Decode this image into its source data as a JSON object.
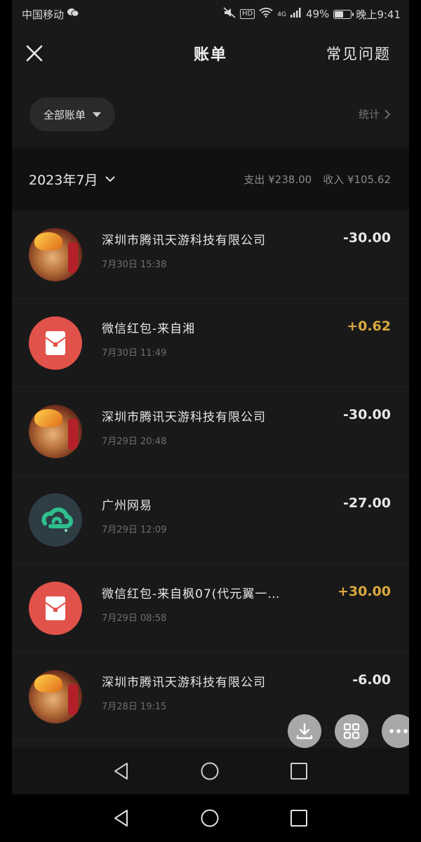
{
  "status_bar": {
    "carrier": "中国移动",
    "hd": "HD",
    "network": "4G",
    "battery": "49%",
    "battery_level": 0.49,
    "time": "晚上9:41"
  },
  "header": {
    "title": "账单",
    "faq": "常见问题"
  },
  "filter": {
    "label": "全部账单",
    "stats": "统计"
  },
  "month": {
    "label": "2023年7月",
    "expense": "支出 ¥238.00",
    "income": "收入 ¥105.62"
  },
  "transactions": [
    {
      "name": "深圳市腾讯天游科技有限公司",
      "time": "7月30日 15:38",
      "amount": "-30.00",
      "type": "expense",
      "icon": "game-hero-avatar"
    },
    {
      "name": "微信红包-来自湘",
      "time": "7月30日 11:49",
      "amount": "+0.62",
      "type": "income",
      "icon": "red-packet-icon"
    },
    {
      "name": "深圳市腾讯天游科技有限公司",
      "time": "7月29日 20:48",
      "amount": "-30.00",
      "type": "expense",
      "icon": "game-hero-avatar"
    },
    {
      "name": "广州网易",
      "time": "7月29日 12:09",
      "amount": "-27.00",
      "type": "expense",
      "icon": "netease-cloud-icon"
    },
    {
      "name": "微信红包-来自枫07(代元翼一…",
      "time": "7月29日 08:58",
      "amount": "+30.00",
      "type": "income",
      "icon": "red-packet-icon"
    },
    {
      "name": "深圳市腾讯天游科技有限公司",
      "time": "7月28日 19:15",
      "amount": "-6.00",
      "type": "expense",
      "icon": "game-hero-avatar"
    }
  ],
  "colors": {
    "background": "#191919",
    "income": "#d9a840",
    "red_packet": "#e0524a"
  }
}
